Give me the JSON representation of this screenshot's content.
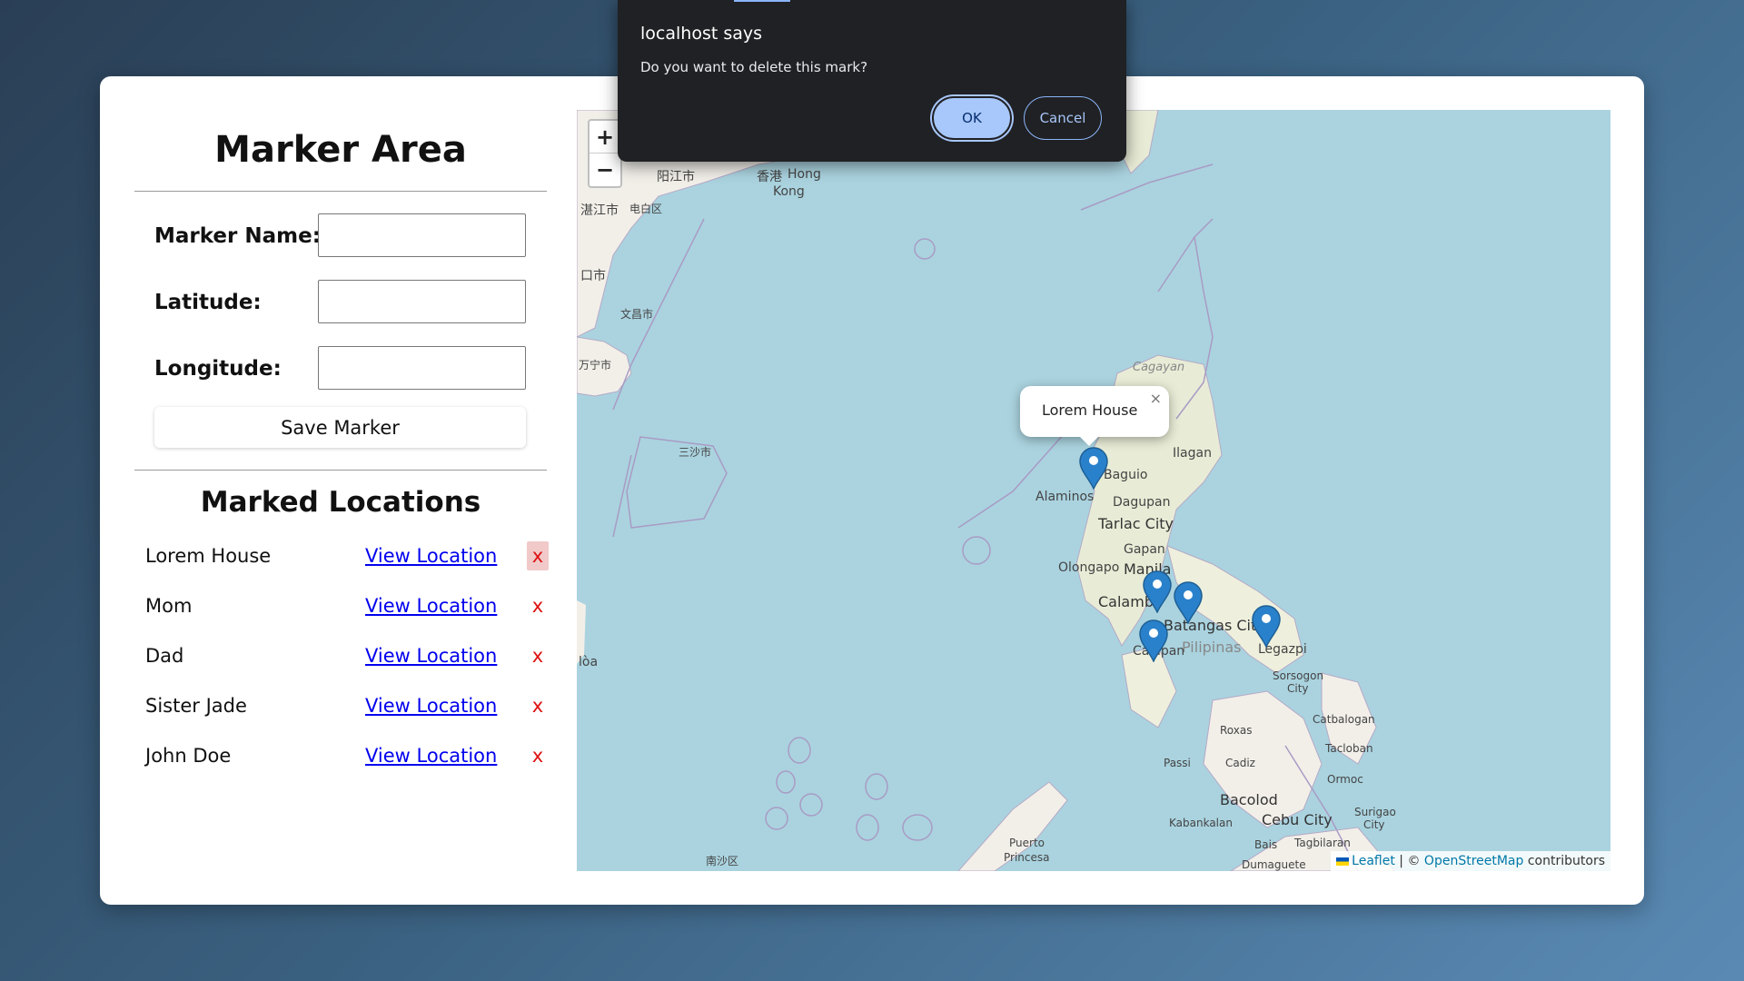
{
  "form": {
    "title": "Marker Area",
    "name_label": "Marker Name:",
    "name_value": "",
    "lat_label": "Latitude:",
    "lat_value": "",
    "lng_label": "Longitude:",
    "lng_value": "",
    "save_label": "Save Marker"
  },
  "locations": {
    "title": "Marked Locations",
    "items": [
      {
        "name": "Lorem House",
        "link": "View Location",
        "delete": "x"
      },
      {
        "name": "Mom",
        "link": "View Location",
        "delete": "x"
      },
      {
        "name": "Dad",
        "link": "View Location",
        "delete": "x"
      },
      {
        "name": "Sister Jade",
        "link": "View Location",
        "delete": "x"
      },
      {
        "name": "John Doe",
        "link": "View Location",
        "delete": "x"
      }
    ]
  },
  "map": {
    "zoom_in": "+",
    "zoom_out": "−",
    "popup_text": "Lorem House",
    "popup_close": "×",
    "places": {
      "yangjiang": "阳江市",
      "hongkong_cn": "香港",
      "hongkong_en": "Hong",
      "hongkong_en2": "Kong",
      "zhanjiang": "湛江市",
      "dianbai": "电白区",
      "wenchang": "文昌市",
      "wanning": "万宁市",
      "sansha": "三沙市",
      "haikou": "口市",
      "nansha": "南沙区",
      "cagayan": "Cagayan",
      "baguio": "Baguio",
      "ilagan": "Ilagan",
      "alaminos": "Alaminos",
      "dagupan": "Dagupan",
      "tarlac": "Tarlac City",
      "gapan": "Gapan",
      "olongapo": "Olongapo",
      "manila": "Manila",
      "calamba": "Calamba",
      "batangas": "Batangas City",
      "pilipinas": "Pilipinas",
      "calapan": "Calapan",
      "legazpi": "Legazpi",
      "sorsogon": "Sorsogon",
      "sorsogon2": "City",
      "roxas": "Roxas",
      "catbalogan": "Catbalogan",
      "tacloban": "Tacloban",
      "ormoc": "Ormoc",
      "passi": "Passi",
      "cadiz": "Cadiz",
      "bacolod": "Bacolod",
      "cebu": "Cebu City",
      "surigao": "Surigao",
      "surigao2": "City",
      "kabankalan": "Kabankalan",
      "bais": "Bais",
      "tagbilaran": "Tagbilaran",
      "puerto": "Puerto",
      "princesa": "Princesa",
      "dumaguete": "Dumaguete",
      "hoa": "lòa"
    },
    "attribution": {
      "leaflet": "Leaflet",
      "sep": "| ©",
      "osm": "OpenStreetMap",
      "contrib": "contributors"
    }
  },
  "dialog": {
    "title": "localhost says",
    "message": "Do you want to delete this mark?",
    "ok": "OK",
    "cancel": "Cancel"
  },
  "colors": {
    "marker": "#2a81cb",
    "water": "#aad3df",
    "land": "#f2efe9"
  }
}
